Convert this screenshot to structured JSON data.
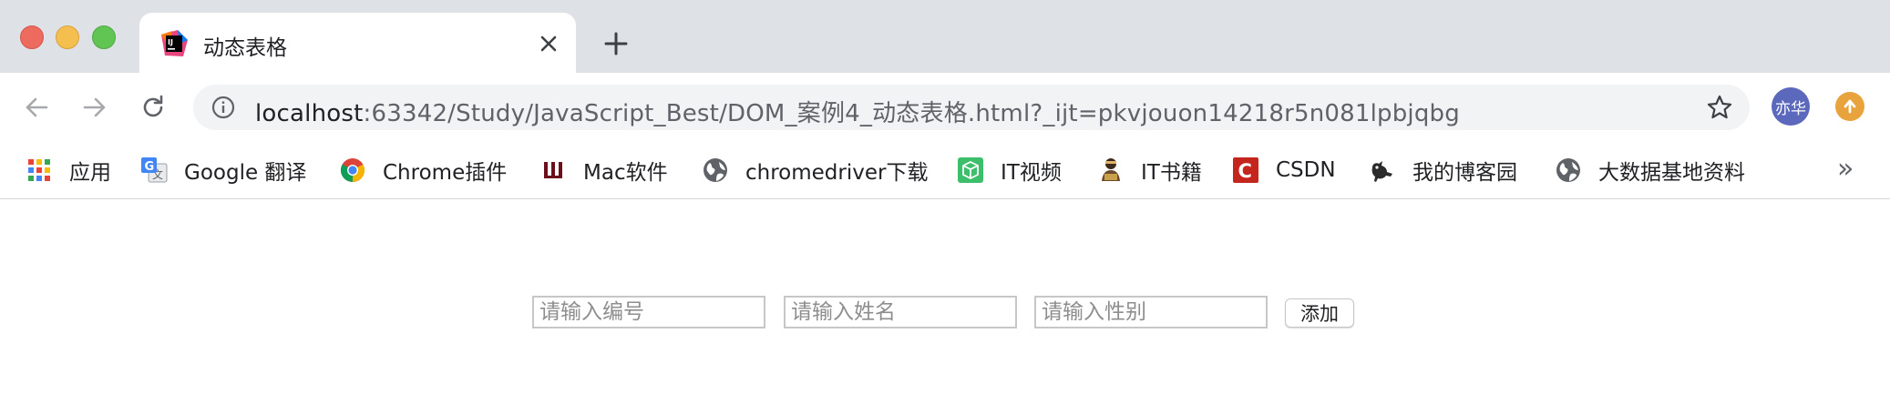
{
  "tab": {
    "title": "动态表格",
    "icon": "intellij-icon"
  },
  "address_bar": {
    "host": "localhost",
    "path": ":63342/Study/JavaScript_Best/DOM_案例4_动态表格.html?_ijt=pkvjouon14218r5n081lpbjqbg"
  },
  "profile": {
    "label": "亦华"
  },
  "bookmarks": [
    {
      "label": "应用",
      "icon": "apps-grid-icon"
    },
    {
      "label": "Google 翻译",
      "icon": "google-translate-icon"
    },
    {
      "label": "Chrome插件",
      "icon": "chrome-icon"
    },
    {
      "label": "Mac软件",
      "icon": "mac-software-icon"
    },
    {
      "label": "chromedriver下载",
      "icon": "globe-icon"
    },
    {
      "label": "IT视频",
      "icon": "cube-icon"
    },
    {
      "label": "IT书籍",
      "icon": "reader-icon"
    },
    {
      "label": "CSDN",
      "icon": "csdn-icon"
    },
    {
      "label": "我的博客园",
      "icon": "cnblogs-icon"
    },
    {
      "label": "大数据基地资料",
      "icon": "globe-icon"
    }
  ],
  "bookmarks_more": "»",
  "form": {
    "id_placeholder": "请输入编号",
    "name_placeholder": "请输入姓名",
    "gender_placeholder": "请输入性别",
    "add_label": "添加"
  }
}
